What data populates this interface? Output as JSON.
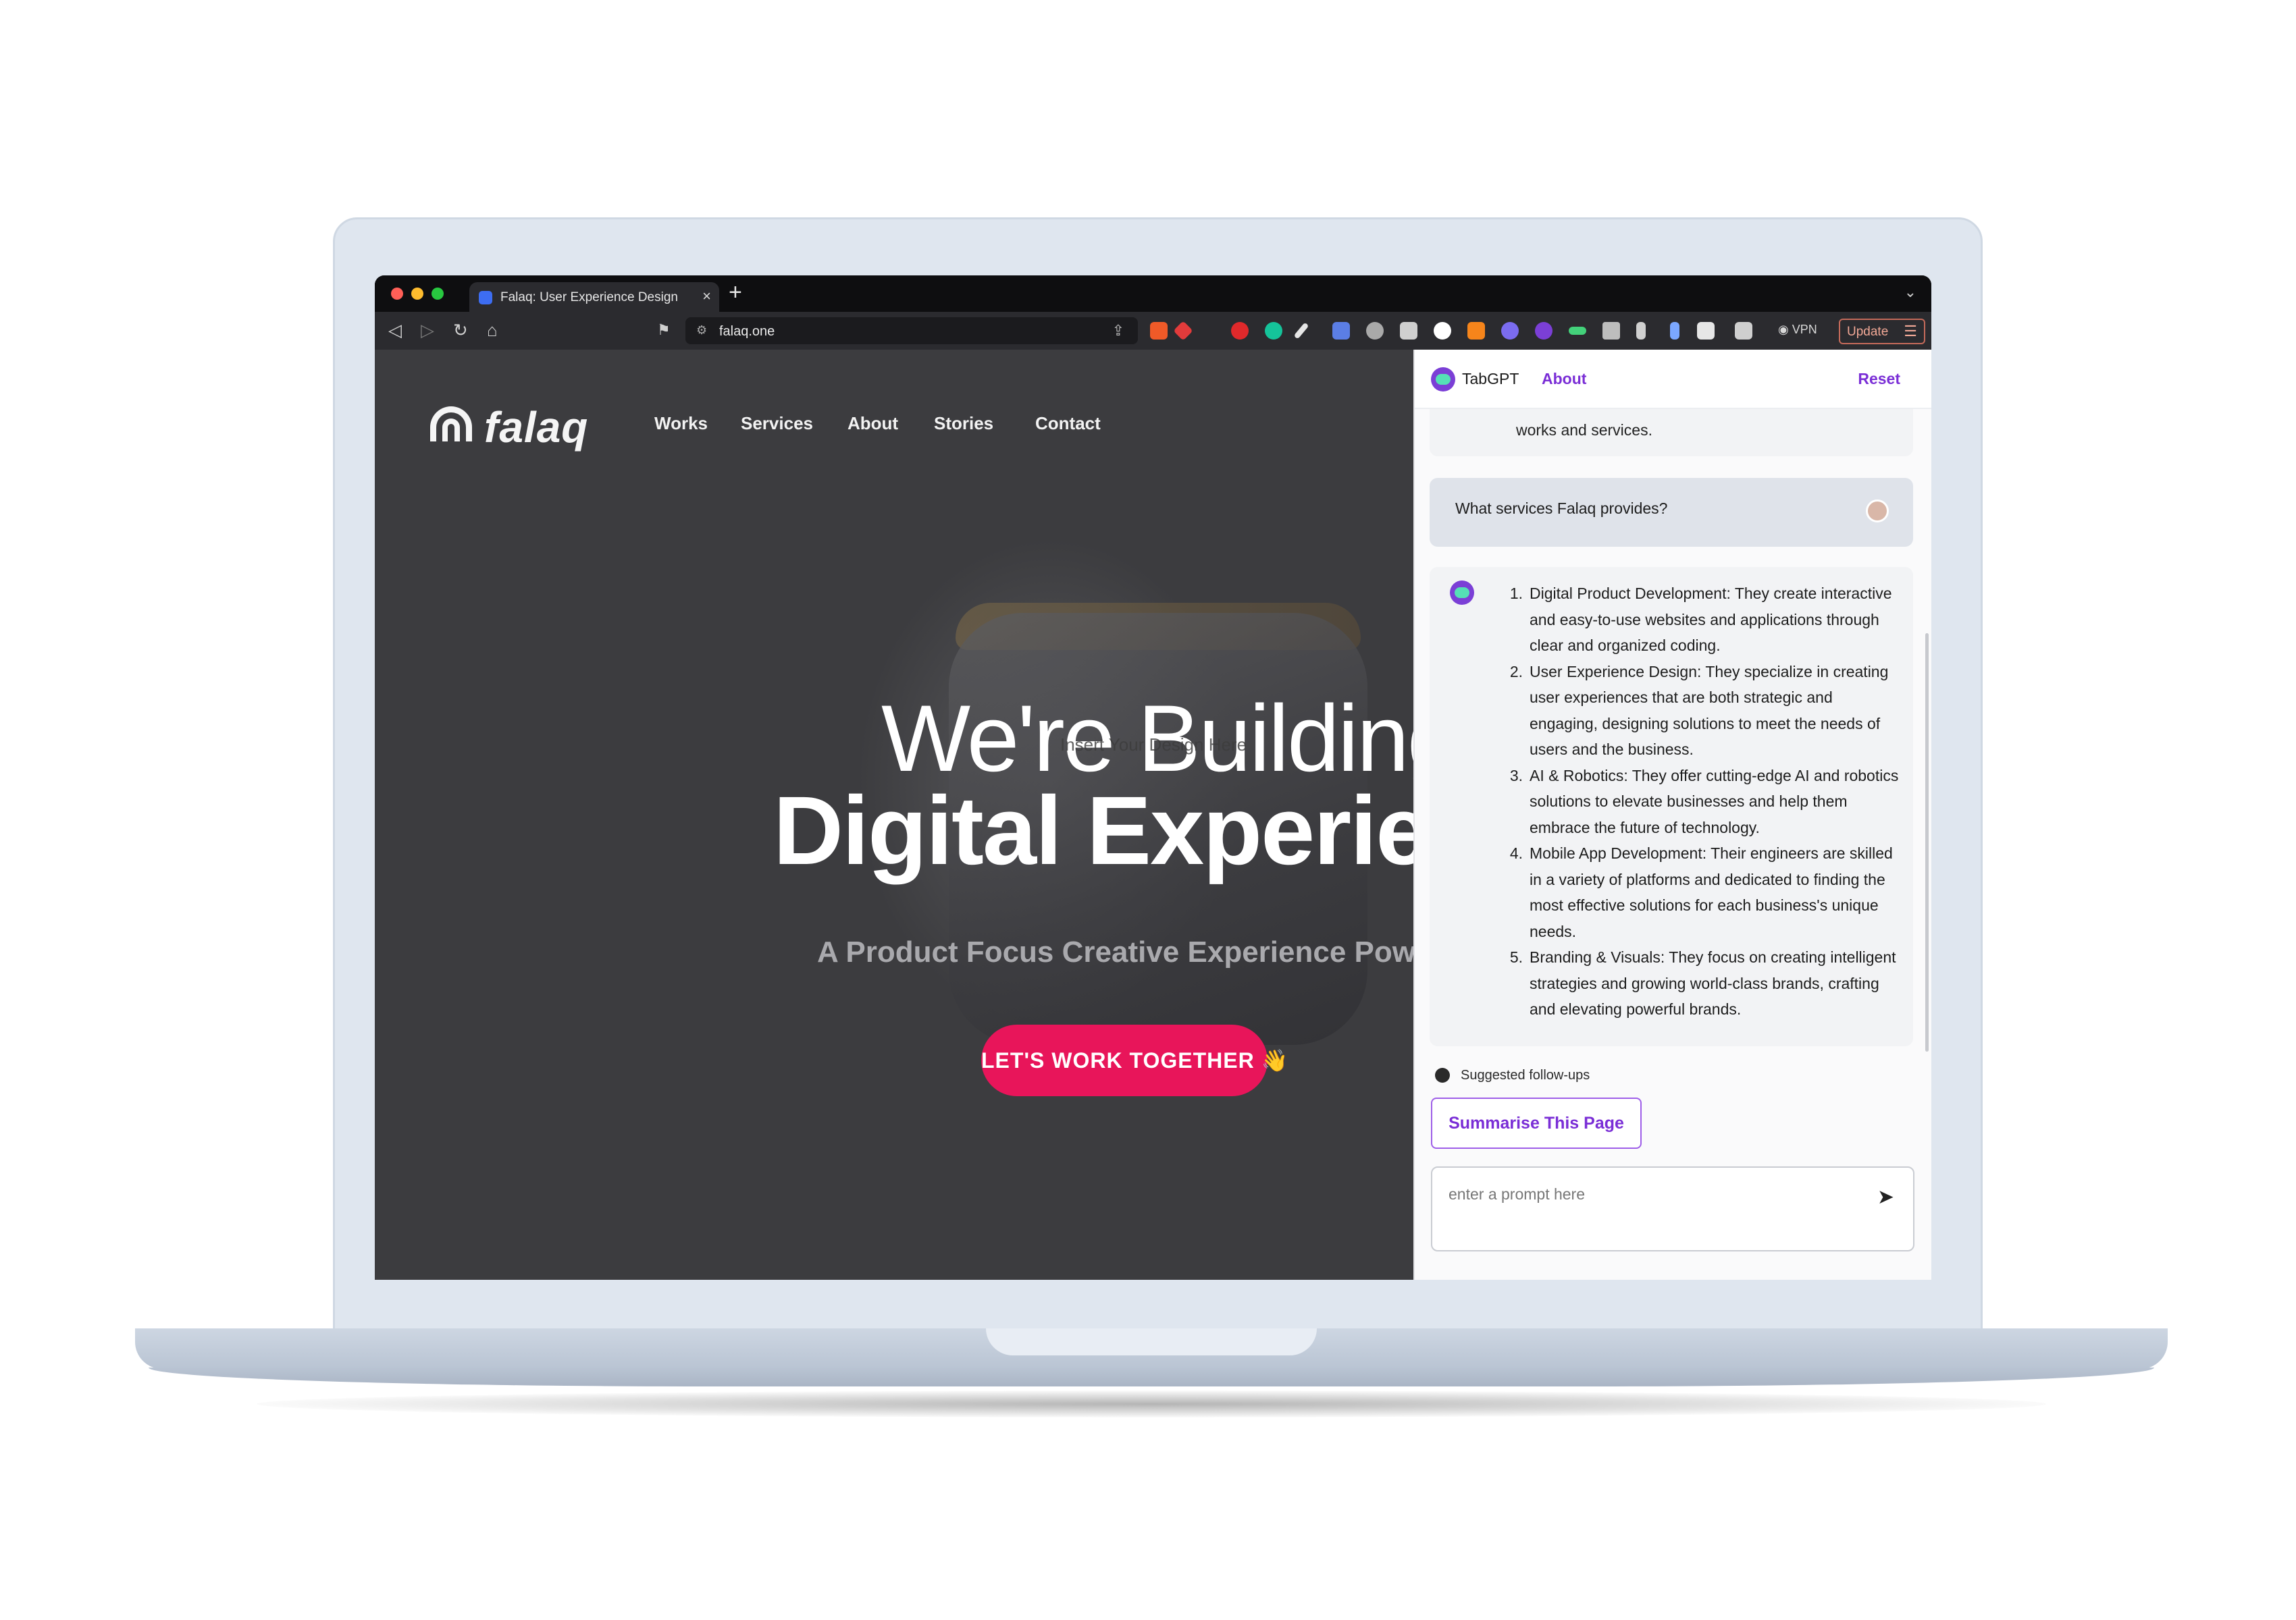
{
  "browser": {
    "tab_title": "Falaq: User Experience Design",
    "tab_close": "×",
    "new_tab": "+",
    "tab_menu": "⌄",
    "url": "falaq.one",
    "vpn_label": "◉ VPN",
    "update_label": "Update",
    "update_menu": "☰",
    "nav_icons": [
      "back-icon",
      "forward-icon",
      "reload-icon",
      "home-icon",
      "bookmark-icon"
    ]
  },
  "site": {
    "logo_text": "falaq",
    "nav": [
      "Works",
      "Services",
      "About",
      "Stories",
      "Contact"
    ],
    "hero_line1": "We're Building",
    "hero_line2": "Digital Experiences",
    "ghost_text": "Insert Your Design Here",
    "hero_sub": "A Product Focus Creative Experience Powerhouse",
    "cta": "LET'S WORK TOGETHER 👋",
    "accent": "#e8155a"
  },
  "panel": {
    "title": "TabGPT",
    "about": "About",
    "reset": "Reset",
    "previous_message_tail": "works and services.",
    "user_message": "What services Falaq provides?",
    "bot_answer": [
      {
        "num": "1.",
        "text": "Digital Product Development: They create interactive and easy-to-use websites and applications through clear and organized coding."
      },
      {
        "num": "2.",
        "text": "User Experience Design: They specialize in creating user experiences that are both strategic and engaging, designing solutions to meet the needs of users and the business."
      },
      {
        "num": "3.",
        "text": "AI & Robotics: They offer cutting-edge AI and robotics solutions to elevate businesses and help them embrace the future of technology."
      },
      {
        "num": "4.",
        "text": "Mobile App Development: Their engineers are skilled in a variety of platforms and dedicated to finding the most effective solutions for each business's unique needs."
      },
      {
        "num": "5.",
        "text": "Branding & Visuals: They focus on creating intelligent strategies and growing world-class brands, crafting and elevating powerful brands."
      }
    ],
    "suggested_label": "Suggested follow-ups",
    "suggested_button": "Summarise This Page",
    "prompt_placeholder": "enter a prompt here",
    "send_icon": "➤",
    "accent": "#7a2ed6"
  }
}
